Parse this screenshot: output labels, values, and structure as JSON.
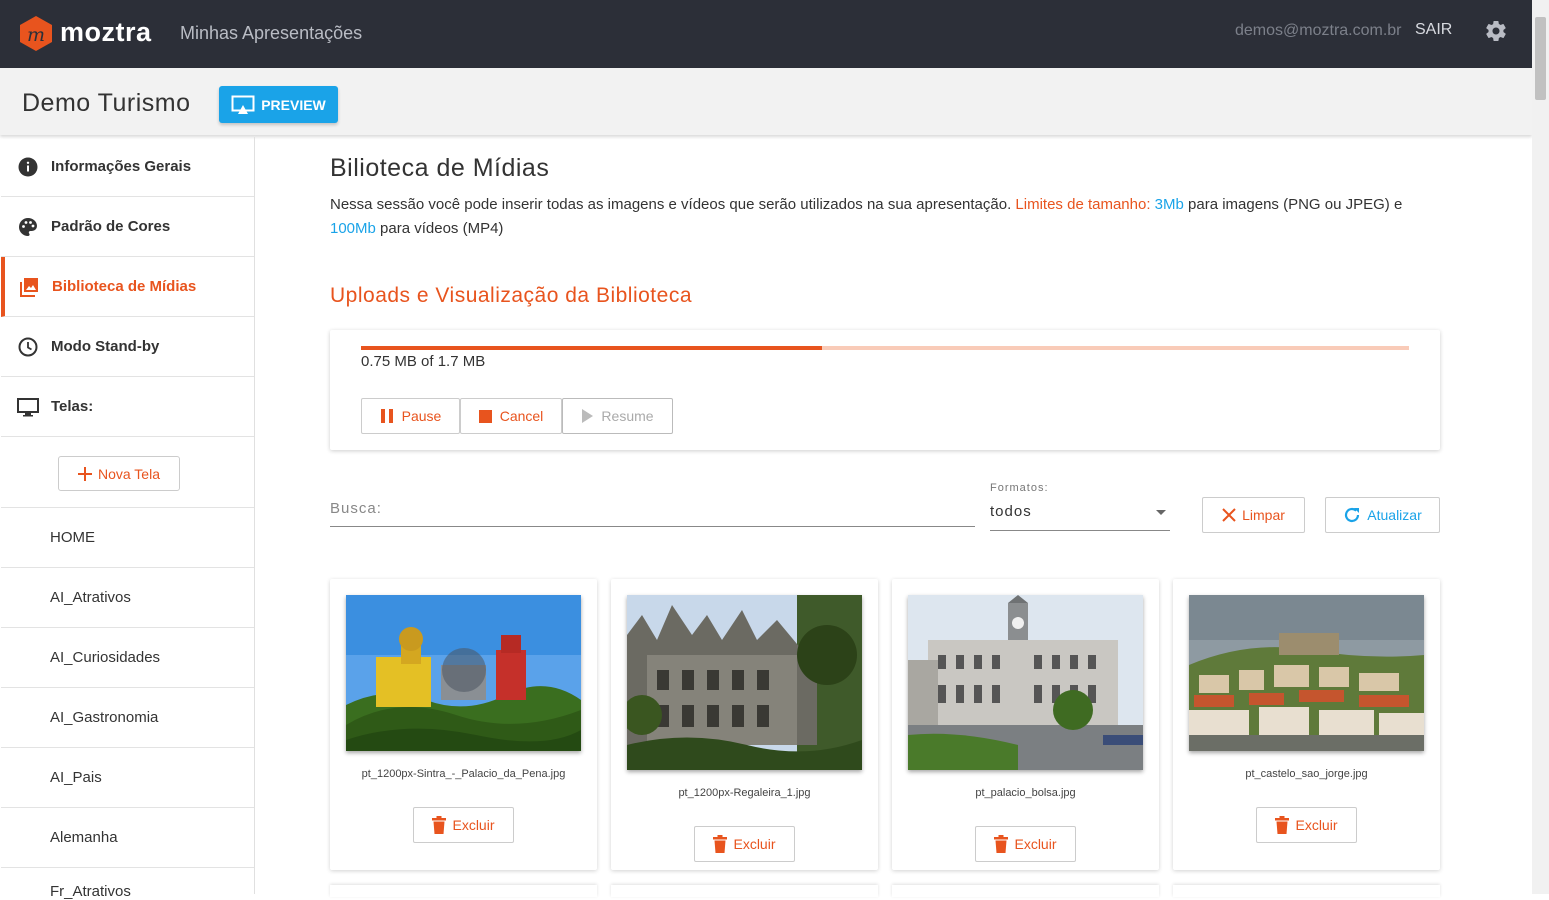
{
  "header": {
    "brand": "moztra",
    "nav_label": "Minhas Apresentações",
    "user_email": "demos@moztra.com.br",
    "logout_label": "SAIR"
  },
  "project": {
    "title": "Demo Turismo",
    "preview_label": "PREVIEW"
  },
  "sidebar": {
    "items": [
      {
        "label": "Informações Gerais",
        "icon": "info-icon"
      },
      {
        "label": "Padrão de Cores",
        "icon": "palette-icon"
      },
      {
        "label": "Biblioteca de Mídias",
        "icon": "image-library-icon",
        "active": true
      },
      {
        "label": "Modo Stand-by",
        "icon": "clock-icon"
      },
      {
        "label": "Telas:",
        "icon": "monitor-icon"
      }
    ],
    "new_screen_label": "Nova Tela",
    "screens": [
      "HOME",
      "AI_Atrativos",
      "AI_Curiosidades",
      "AI_Gastronomia",
      "AI_Pais",
      "Alemanha",
      "Fr_Atrativos"
    ]
  },
  "main": {
    "title": "Bilioteca de Mídias",
    "desc_part1": "Nessa sessão você pode inserir todas as imagens e vídeos que serão utilizados na sua apresentação. ",
    "desc_limits": "Limites de tamanho: ",
    "desc_image_limit": "3Mb",
    "desc_part2": " para imagens (PNG ou JPEG) e ",
    "desc_video_limit": "100Mb",
    "desc_part3": " para vídeos (MP4)",
    "section_title": "Uploads e Visualização da Biblioteca"
  },
  "upload": {
    "progress_fraction": 0.44,
    "progress_text": "0.75 MB of 1.7 MB",
    "pause_label": "Pause",
    "cancel_label": "Cancel",
    "resume_label": "Resume"
  },
  "filters": {
    "search_label": "Busca:",
    "format_label": "Formatos:",
    "format_value": "todos",
    "clear_label": "Limpar",
    "refresh_label": "Atualizar"
  },
  "media": [
    {
      "filename": "pt_1200px-Sintra_-_Palacio_da_Pena.jpg",
      "delete_label": "Excluir"
    },
    {
      "filename": "pt_1200px-Regaleira_1.jpg",
      "delete_label": "Excluir"
    },
    {
      "filename": "pt_palacio_bolsa.jpg",
      "delete_label": "Excluir"
    },
    {
      "filename": "pt_castelo_sao_jorge.jpg",
      "delete_label": "Excluir"
    }
  ],
  "colors": {
    "accent": "#e8541e",
    "brand_blue": "#1aa3e8",
    "header_bg": "#2c2f38"
  }
}
